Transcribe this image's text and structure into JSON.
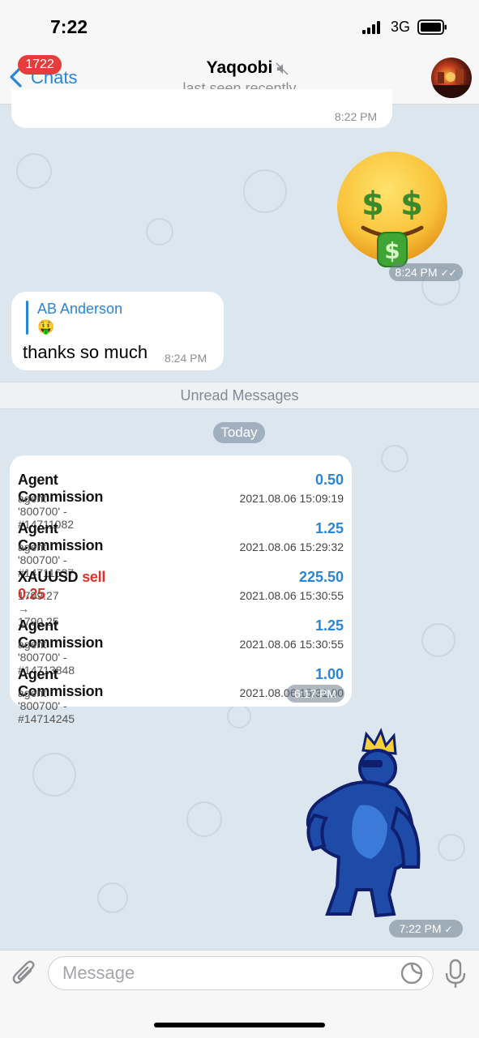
{
  "status_bar": {
    "time": "7:22",
    "network": "3G"
  },
  "header": {
    "back_label": "Chats",
    "unread_badge": "1722",
    "title": "Yaqoobi",
    "subtitle": "last seen recently"
  },
  "messages": {
    "m1_time": "8:22 PM",
    "m2_time": "8:24 PM",
    "m3": {
      "reply_name": "AB Anderson",
      "reply_emoji": "🤑",
      "text": "thanks so much",
      "time": "8:24 PM"
    },
    "unread_label": "Unread Messages",
    "date_label": "Today",
    "report": {
      "time": "6:17 PM",
      "rows": [
        {
          "title": "Agent Commission",
          "highlight": "",
          "amount": "0.50",
          "sub": "agent '800700' - #14711082",
          "date": "2021.08.06 15:09:19"
        },
        {
          "title": "Agent Commission",
          "highlight": "",
          "amount": "1.25",
          "sub": "agent '800700' - #14711637",
          "date": "2021.08.06 15:29:32"
        },
        {
          "title": "XAUUSD",
          "highlight": "sell 0.25",
          "amount": "225.50",
          "sub": "1799.27 → 1790.25",
          "date": "2021.08.06 15:30:55"
        },
        {
          "title": "Agent Commission",
          "highlight": "",
          "amount": "1.25",
          "sub": "agent '800700' - #14713848",
          "date": "2021.08.06 15:30:55"
        },
        {
          "title": "Agent Commission",
          "highlight": "",
          "amount": "1.00",
          "sub": "agent '800700' - #14714245",
          "date": "2021.08.06 15:31:00"
        }
      ]
    },
    "sticker_time": "7:22 PM"
  },
  "composer": {
    "placeholder": "Message"
  },
  "colors": {
    "accent": "#2a85d4",
    "badge": "#e53d3c",
    "sell": "#d9342b",
    "chat_bg": "#dce6ef"
  },
  "icons": [
    "back-chevron-icon",
    "mute-icon",
    "attach-icon",
    "sticker-icon",
    "mic-icon",
    "signal-icon",
    "battery-icon",
    "read-check-icon"
  ]
}
